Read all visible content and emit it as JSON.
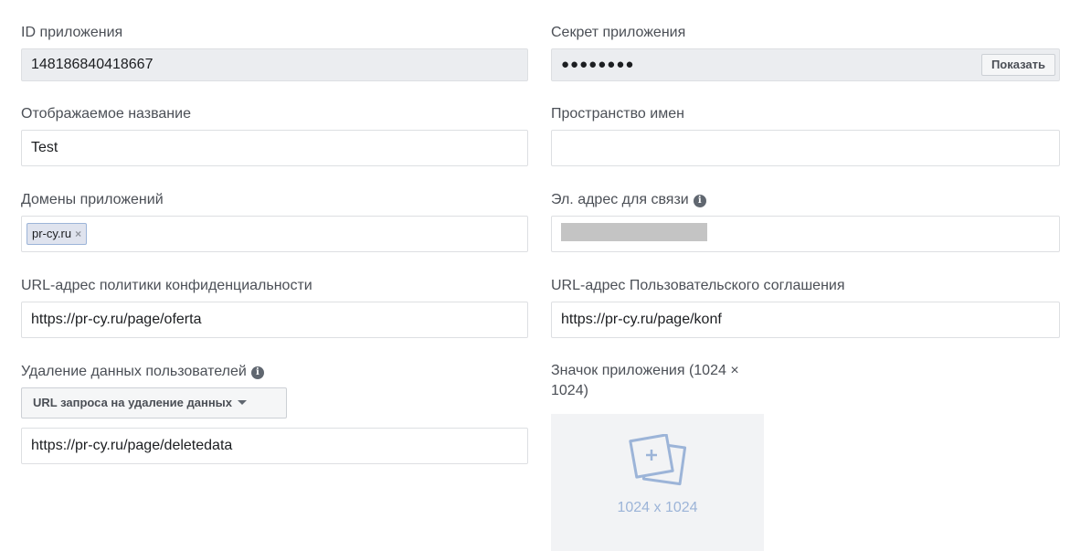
{
  "left": {
    "app_id": {
      "label": "ID приложения",
      "value": "148186840418667"
    },
    "display_name": {
      "label": "Отображаемое название",
      "value": "Test"
    },
    "app_domains": {
      "label": "Домены приложений",
      "tags": [
        "pr-cy.ru"
      ],
      "remove_glyph": "×"
    },
    "privacy_url": {
      "label": "URL-адрес политики конфиденциальности",
      "value": "https://pr-cy.ru/page/oferta"
    },
    "data_deletion": {
      "label": "Удаление данных пользователей",
      "dropdown_label": "URL запроса на удаление данных",
      "value": "https://pr-cy.ru/page/deletedata"
    }
  },
  "right": {
    "app_secret": {
      "label": "Секрет приложения",
      "value": "●●●●●●●●",
      "show_label": "Показать"
    },
    "namespace": {
      "label": "Пространство имен",
      "value": ""
    },
    "contact_email": {
      "label": "Эл. адрес для связи"
    },
    "terms_url": {
      "label": "URL-адрес Пользовательского соглашения",
      "value": "https://pr-cy.ru/page/konf"
    },
    "app_icon": {
      "label_line1": "Значок приложения (1024 ×",
      "label_line2": "1024)",
      "size_text": "1024 x 1024"
    }
  },
  "icons": {
    "info": "info-icon",
    "image_placeholder": "image-placeholder-icon"
  },
  "colors": {
    "readonly_bg": "#ebedf0",
    "tag_bg": "#dfe3ee",
    "placeholder": "#9cb4d8"
  }
}
